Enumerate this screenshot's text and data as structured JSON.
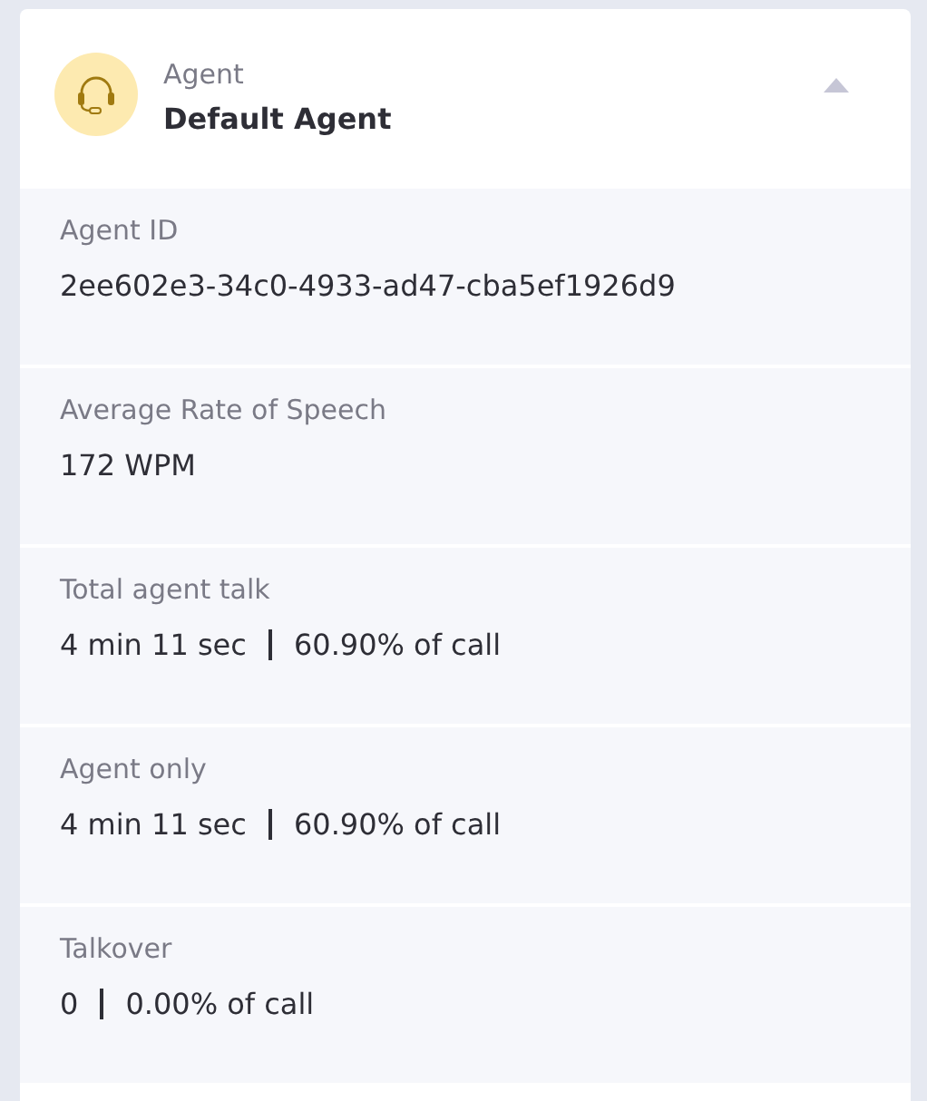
{
  "header": {
    "label": "Agent",
    "name": "Default Agent",
    "expanded": true
  },
  "sections": [
    {
      "label": "Agent ID",
      "values": [
        "2ee602e3-34c0-4933-ad47-cba5ef1926d9"
      ]
    },
    {
      "label": "Average Rate of Speech",
      "values": [
        "172 WPM"
      ]
    },
    {
      "label": "Total agent talk",
      "values": [
        "4 min 11 sec",
        "60.90% of call"
      ]
    },
    {
      "label": "Agent only",
      "values": [
        "4 min 11 sec",
        "60.90% of call"
      ]
    },
    {
      "label": "Talkover",
      "values": [
        "0",
        "0.00% of call"
      ]
    }
  ]
}
